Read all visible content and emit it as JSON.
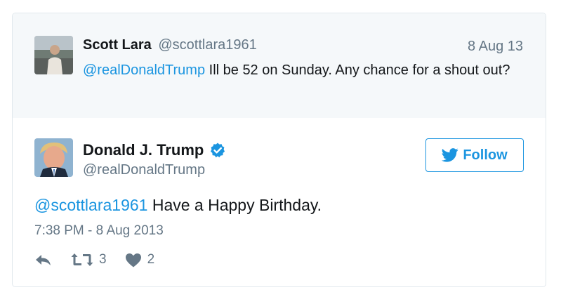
{
  "reply_tweet": {
    "name": "Scott Lara",
    "handle": "@scottlara1961",
    "date": "8 Aug 13",
    "mention": "@realDonaldTrump",
    "text": " Ill be 52 on Sunday. Any chance for a shout out?"
  },
  "main_tweet": {
    "name": "Donald J. Trump",
    "handle": "@realDonaldTrump",
    "verified_icon": "verified-badge-icon",
    "follow_label": "Follow",
    "mention": "@scottlara1961",
    "text": " Have a Happy Birthday.",
    "timestamp": "7:38 PM - 8 Aug 2013",
    "retweet_count": "3",
    "like_count": "2"
  },
  "colors": {
    "link": "#1b95e0",
    "muted": "#657786",
    "reply_bg": "#f5f8fa",
    "border": "#e1e8ed"
  }
}
